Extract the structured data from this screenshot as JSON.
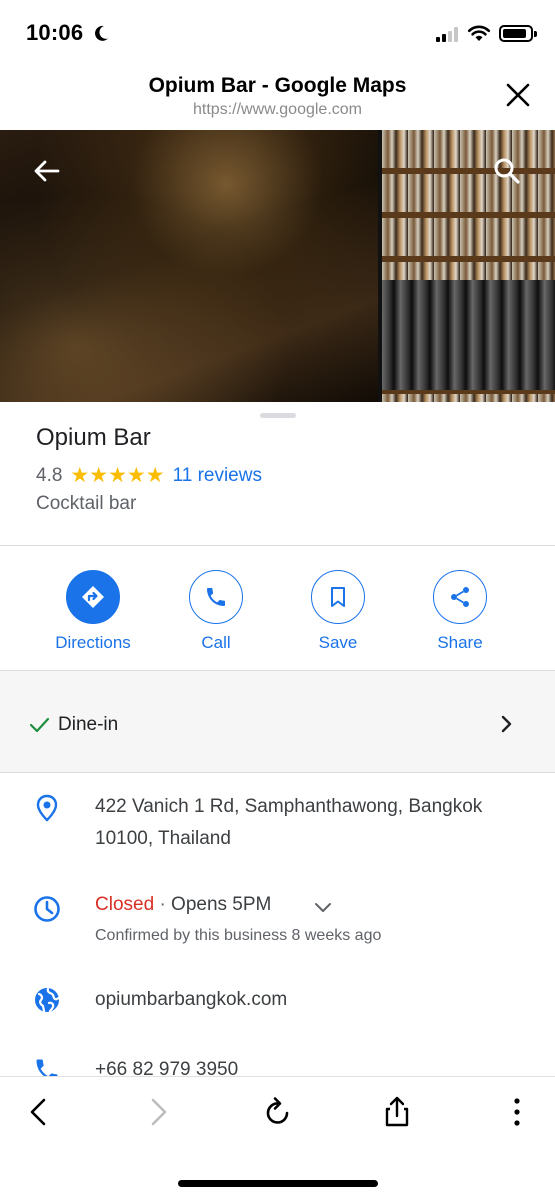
{
  "status_bar": {
    "time": "10:06"
  },
  "browser": {
    "title": "Opium Bar - Google Maps",
    "url": "https://www.google.com"
  },
  "place": {
    "name": "Opium Bar",
    "rating": "4.8",
    "stars": "★★★★★",
    "stars_value": 4.8,
    "reviews": "11 reviews",
    "category": "Cocktail bar"
  },
  "actions": [
    {
      "label": "Directions",
      "icon": "directions-icon"
    },
    {
      "label": "Call",
      "icon": "phone-icon"
    },
    {
      "label": "Save",
      "icon": "bookmark-icon"
    },
    {
      "label": "Share",
      "icon": "share-icon"
    }
  ],
  "dine_in": {
    "label": "Dine-in"
  },
  "info": {
    "address_line1": "422 Vanich 1 Rd, Samphanthawong, Bangkok",
    "address_line2": "10100, Thailand",
    "hours_status": "Closed",
    "hours_sep": "·",
    "hours_opens": "Opens 5PM",
    "hours_confirmed": "Confirmed by this business 8 weeks ago",
    "website": "opiumbarbangkok.com",
    "phone": "+66 82 979 3950"
  },
  "colors": {
    "accent": "#1a73e8",
    "closed": "#d93025",
    "star": "#fbbc04",
    "check": "#1e8e3e"
  }
}
